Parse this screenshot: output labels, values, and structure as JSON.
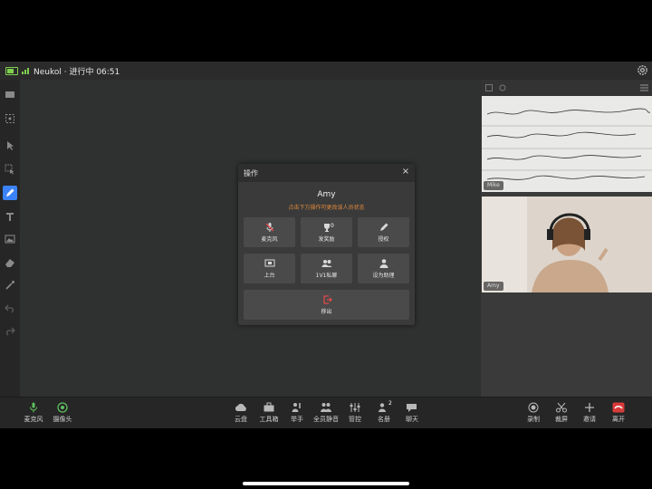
{
  "status_bar": {
    "title": "Neukol · 进行中 06:51"
  },
  "left_toolbar": {
    "tools": [
      "chat-icon",
      "screenshot-icon",
      "pointer-icon",
      "select-icon",
      "pen-icon",
      "text-icon",
      "image-icon",
      "eraser-icon",
      "laser-icon",
      "undo-icon",
      "redo-icon"
    ],
    "active_tool": "pen-icon"
  },
  "videos": [
    {
      "label": "Mike"
    },
    {
      "label": "Amy"
    }
  ],
  "dialog": {
    "title": "操作",
    "close": "×",
    "name": "Amy",
    "hint": "点击下方操作可更改该人员状态",
    "tiles": [
      {
        "label": "麦克风"
      },
      {
        "label": "发奖励",
        "count": "0"
      },
      {
        "label": "授权"
      },
      {
        "label": "上台"
      },
      {
        "label": "1V1私聊"
      },
      {
        "label": "设为助理"
      },
      {
        "label": "移出"
      }
    ]
  },
  "bottom_bar": {
    "left": [
      {
        "label": "麦克风"
      },
      {
        "label": "摄像头"
      }
    ],
    "center": [
      {
        "label": "云盘"
      },
      {
        "label": "工具箱"
      },
      {
        "label": "举手"
      },
      {
        "label": "全员静音"
      },
      {
        "label": "管控"
      },
      {
        "label": "名册",
        "badge": "2"
      },
      {
        "label": "聊天"
      }
    ],
    "right": [
      {
        "label": "录制"
      },
      {
        "label": "裁屏"
      },
      {
        "label": "邀请"
      },
      {
        "label": "离开"
      }
    ]
  },
  "colors": {
    "accent_active": "#3b82f6",
    "hint": "#e08a3a",
    "leave": "#d93a3a",
    "mic_green": "#5fbf5f"
  }
}
